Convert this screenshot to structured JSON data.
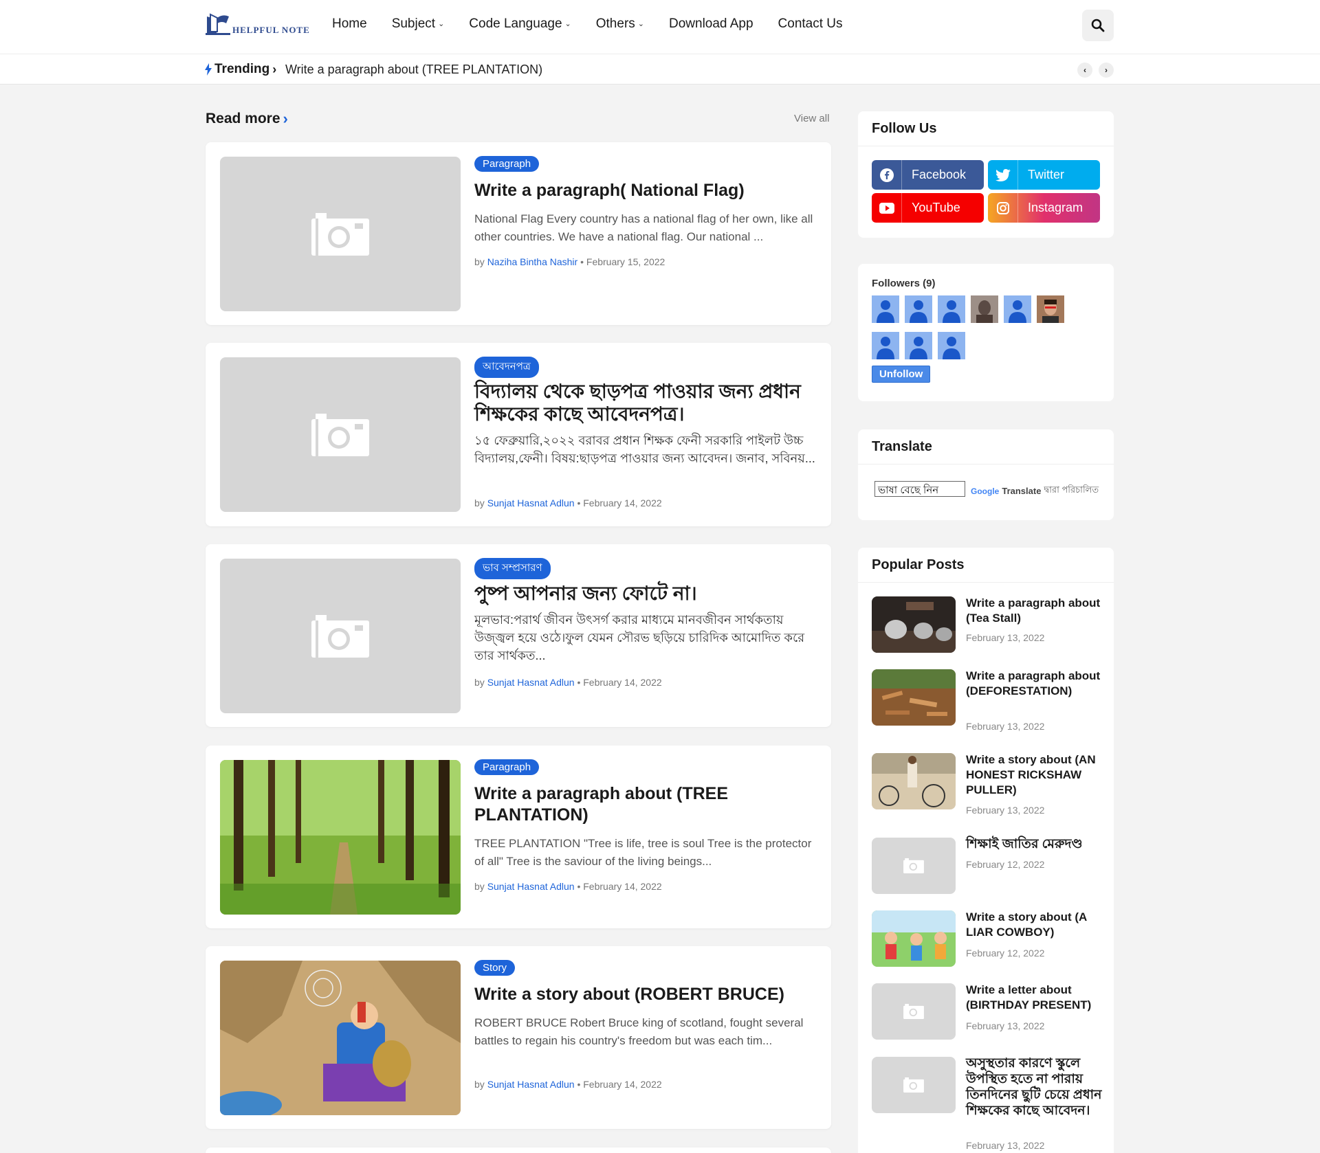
{
  "header": {
    "logo_text": "HELPFUL NOTE",
    "nav": [
      {
        "label": "Home",
        "has_dropdown": false
      },
      {
        "label": "Subject",
        "has_dropdown": true
      },
      {
        "label": "Code Language",
        "has_dropdown": true
      },
      {
        "label": "Others",
        "has_dropdown": true
      },
      {
        "label": "Download App",
        "has_dropdown": false
      },
      {
        "label": "Contact Us",
        "has_dropdown": false
      }
    ],
    "search_icon": "search-icon"
  },
  "trending": {
    "label": "Trending",
    "text": "Write a paragraph about (TREE PLANTATION)"
  },
  "main": {
    "section_title": "Read more",
    "view_all": "View all",
    "posts": [
      {
        "category": "Paragraph",
        "title": "Write a paragraph( National Flag)",
        "excerpt": "National Flag Every country has a national flag of her own, like all other countries. We have a national flag. Our national ...",
        "by": "by",
        "author": "Naziha Bintha Nashir",
        "date": "February 15, 2022",
        "image": "placeholder",
        "lang": "en"
      },
      {
        "category": "আবেদনপত্র",
        "title": "বিদ্যালয় থেকে ছাড়পত্র পাওয়ার জন্য প্রধান শিক্ষকের কাছে আবেদনপত্র।",
        "excerpt": "১৫ ফেব্রুয়ারি,২০২২ বরাবর প্রধান শিক্ষক ফেনী সরকারি পাইলট উচ্চ বিদ্যালয়,ফেনী। বিষয়:ছাড়পত্র পাওয়ার জন্য আবেদন। জনাব, সবিনয়...",
        "by": "by",
        "author": "Sunjat Hasnat Adlun",
        "date": "February 14, 2022",
        "image": "placeholder",
        "lang": "bn"
      },
      {
        "category": "ভাব সম্প্রসারণ",
        "title": "পুষ্প আপনার জন্য ফোটে না।",
        "excerpt": "মূলভাব:পরার্থ জীবন উৎসর্গ করার মাধ্যমে মানবজীবন সার্থকতায় উজ্জ্বল হয়ে ওঠে।ফুল যেমন সৌরভ ছড়িয়ে চারিদিক আমোদিত করে তার সার্থকত...",
        "by": "by",
        "author": "Sunjat Hasnat Adlun",
        "date": "February 14, 2022",
        "image": "placeholder",
        "lang": "bn"
      },
      {
        "category": "Paragraph",
        "title": "Write a paragraph about (TREE PLANTATION)",
        "excerpt": "TREE PLANTATION \"Tree is life, tree is soul Tree is the protector of all\" Tree is the saviour of the living beings...",
        "by": "by",
        "author": "Sunjat Hasnat Adlun",
        "date": "February 14, 2022",
        "image": "forest",
        "lang": "en"
      },
      {
        "category": "Story",
        "title": "Write a story about (ROBERT BRUCE)",
        "excerpt": "ROBERT BRUCE Robert Bruce king of scotland, fought several battles to regain his country's freedom but was each tim...",
        "by": "by",
        "author": "Sunjat Hasnat Adlun",
        "date": "February 14, 2022",
        "image": "cave",
        "lang": "en"
      }
    ]
  },
  "sidebar": {
    "follow": {
      "title": "Follow Us",
      "buttons": [
        {
          "label": "Facebook",
          "icon": "facebook-icon",
          "color": "#3b5998"
        },
        {
          "label": "Twitter",
          "icon": "twitter-icon",
          "color": "#00acee"
        },
        {
          "label": "YouTube",
          "icon": "youtube-icon",
          "color": "#f50000"
        },
        {
          "label": "Instagram",
          "icon": "instagram-icon",
          "color": "#c13584"
        }
      ]
    },
    "followers": {
      "title": "Followers (9)",
      "button": "Unfollow"
    },
    "translate": {
      "title": "Translate",
      "select_value": "ভাষা বেছে নিন",
      "powered_brand": "Google",
      "powered_word": "Translate",
      "powered_suffix": "দ্বারা পরিচালিত"
    },
    "popular": {
      "title": "Popular Posts",
      "items": [
        {
          "title": "Write a paragraph about (Tea Stall)",
          "date": "February 13, 2022",
          "image": "tea",
          "lang": "en"
        },
        {
          "title": "Write a paragraph about (DEFORESTATION)",
          "date": "February 13, 2022",
          "image": "deforest",
          "lang": "en"
        },
        {
          "title": "Write a story about (AN HONEST RICKSHAW PULLER)",
          "date": "February 13, 2022",
          "image": "rickshaw",
          "lang": "en"
        },
        {
          "title": "শিক্ষাই জাতির মেরুদণ্ড",
          "date": "February 12, 2022",
          "image": "placeholder",
          "lang": "bn"
        },
        {
          "title": "Write a story about (A LIAR COWBOY)",
          "date": "February 12, 2022",
          "image": "cowboy",
          "lang": "en"
        },
        {
          "title": "Write a letter about (BIRTHDAY PRESENT)",
          "date": "February 13, 2022",
          "image": "placeholder",
          "lang": "en"
        },
        {
          "title": "অসুস্থতার কারণে স্কুলে উপস্থিত হতে না পারায় তিনদিনের ছুটি চেয়ে প্রধান শিক্ষকের কাছে আবেদন।",
          "date": "February 13, 2022",
          "image": "placeholder",
          "lang": "bn"
        }
      ]
    }
  },
  "colors": {
    "accent": "#1e64d9",
    "background": "#f3f3f3"
  }
}
